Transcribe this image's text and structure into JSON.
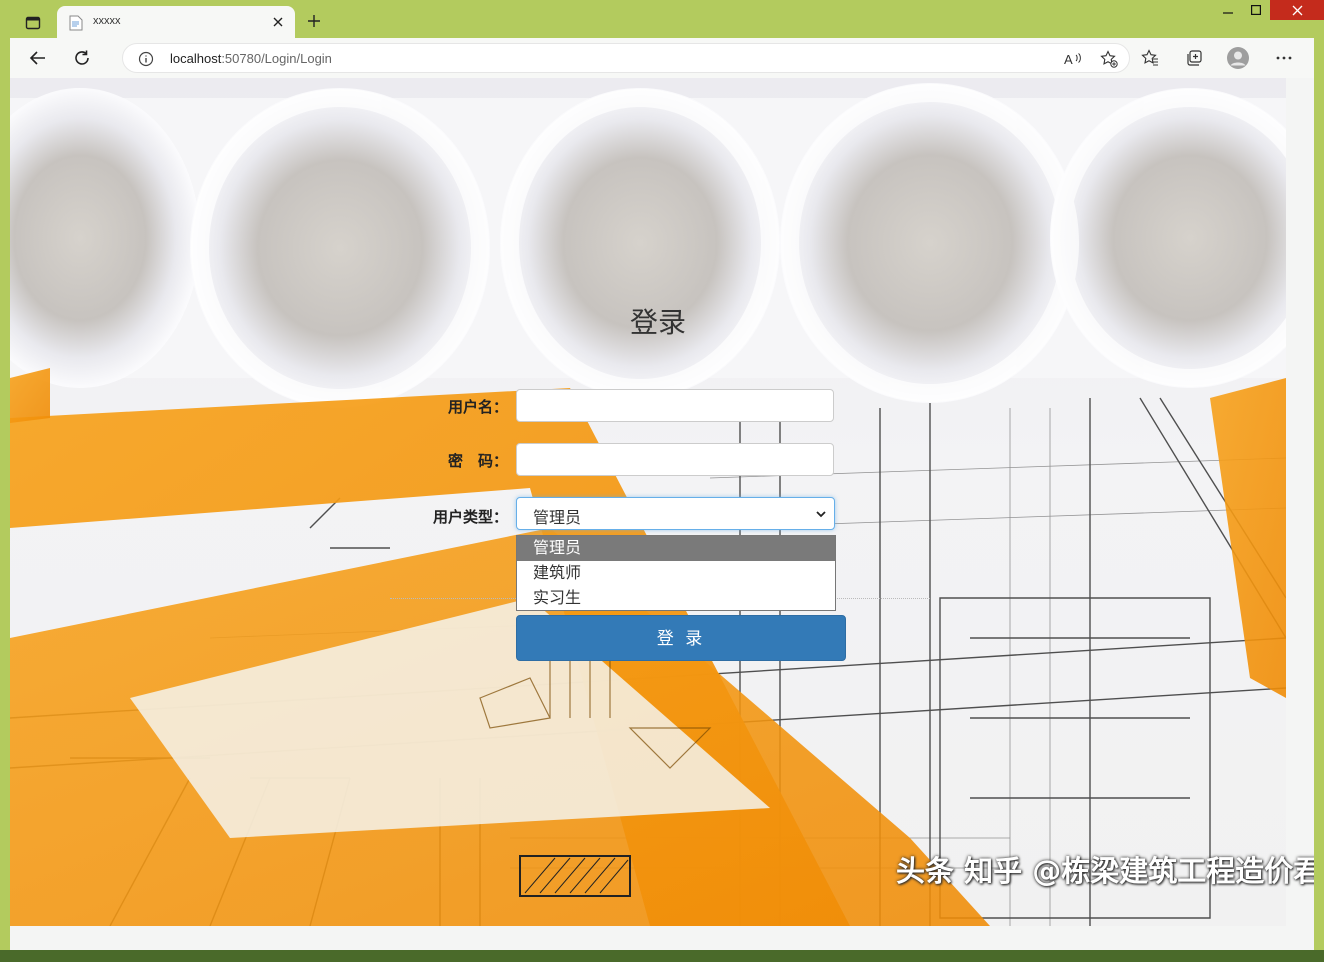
{
  "window": {
    "tab_title": "xxxxx",
    "new_tab_label": "+",
    "accent": "#b3cb5e",
    "close_color": "#c42b1c"
  },
  "toolbar": {
    "url_host": "localhost",
    "url_rest": ":50780/Login/Login"
  },
  "login": {
    "title": "登录",
    "username_label": "用户名：",
    "username_value": "",
    "password_label": "密　码：",
    "password_value": "",
    "usertype_label": "用户类型：",
    "usertype_selected": "管理员",
    "usertype_options": [
      "管理员",
      "建筑师",
      "实习生"
    ],
    "submit_label": "登 录",
    "button_color": "#337ab7"
  },
  "watermark": {
    "text": "头条 知乎 @栋梁建筑工程造价君"
  }
}
